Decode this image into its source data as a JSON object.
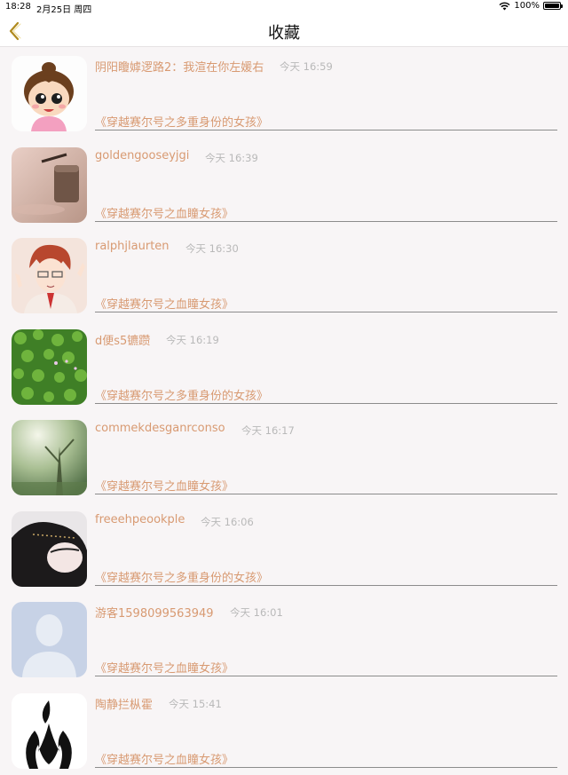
{
  "status_bar": {
    "time": "18:28",
    "date": "2月25日 周四",
    "battery": "100%",
    "battery_level": 1.0
  },
  "nav": {
    "title": "收藏",
    "back_icon": "chevron-left-icon"
  },
  "colors": {
    "accent": "#d89a72",
    "time_text": "#b9b9b9",
    "background": "#f8f5f6"
  },
  "favorites": [
    {
      "name": "阴阳矎嫭逻路2：我渲在你左媛右",
      "time": "今天 16:59",
      "book": "《穿越赛尔号之多重身份的女孩》",
      "avatar": "cartoon-girl-avatar"
    },
    {
      "name": "goldengooseyjgi",
      "time": "今天 16:39",
      "book": "《穿越赛尔号之血瞳女孩》",
      "avatar": "coffee-cup-avatar"
    },
    {
      "name": "ralphjlaurten",
      "time": "今天 16:30",
      "book": "《穿越赛尔号之血瞳女孩》",
      "avatar": "anime-boy-avatar"
    },
    {
      "name": "d便s5镳躜",
      "time": "今天 16:19",
      "book": "《穿越赛尔号之多重身份的女孩》",
      "avatar": "clover-field-avatar"
    },
    {
      "name": "commekdesganrconso",
      "time": "今天 16:17",
      "book": "《穿越赛尔号之血瞳女孩》",
      "avatar": "forest-light-avatar"
    },
    {
      "name": "freeehpeookple",
      "time": "今天 16:06",
      "book": "《穿越赛尔号之多重身份的女孩》",
      "avatar": "girl-photo-avatar"
    },
    {
      "name": "游客1598099563949",
      "time": "今天 16:01",
      "book": "《穿越赛尔号之血瞳女孩》",
      "avatar": "default-user-avatar"
    },
    {
      "name": "陶静拦枞霍",
      "time": "今天 15:41",
      "book": "《穿越赛尔号之血瞳女孩》",
      "avatar": "black-symbol-avatar"
    }
  ]
}
